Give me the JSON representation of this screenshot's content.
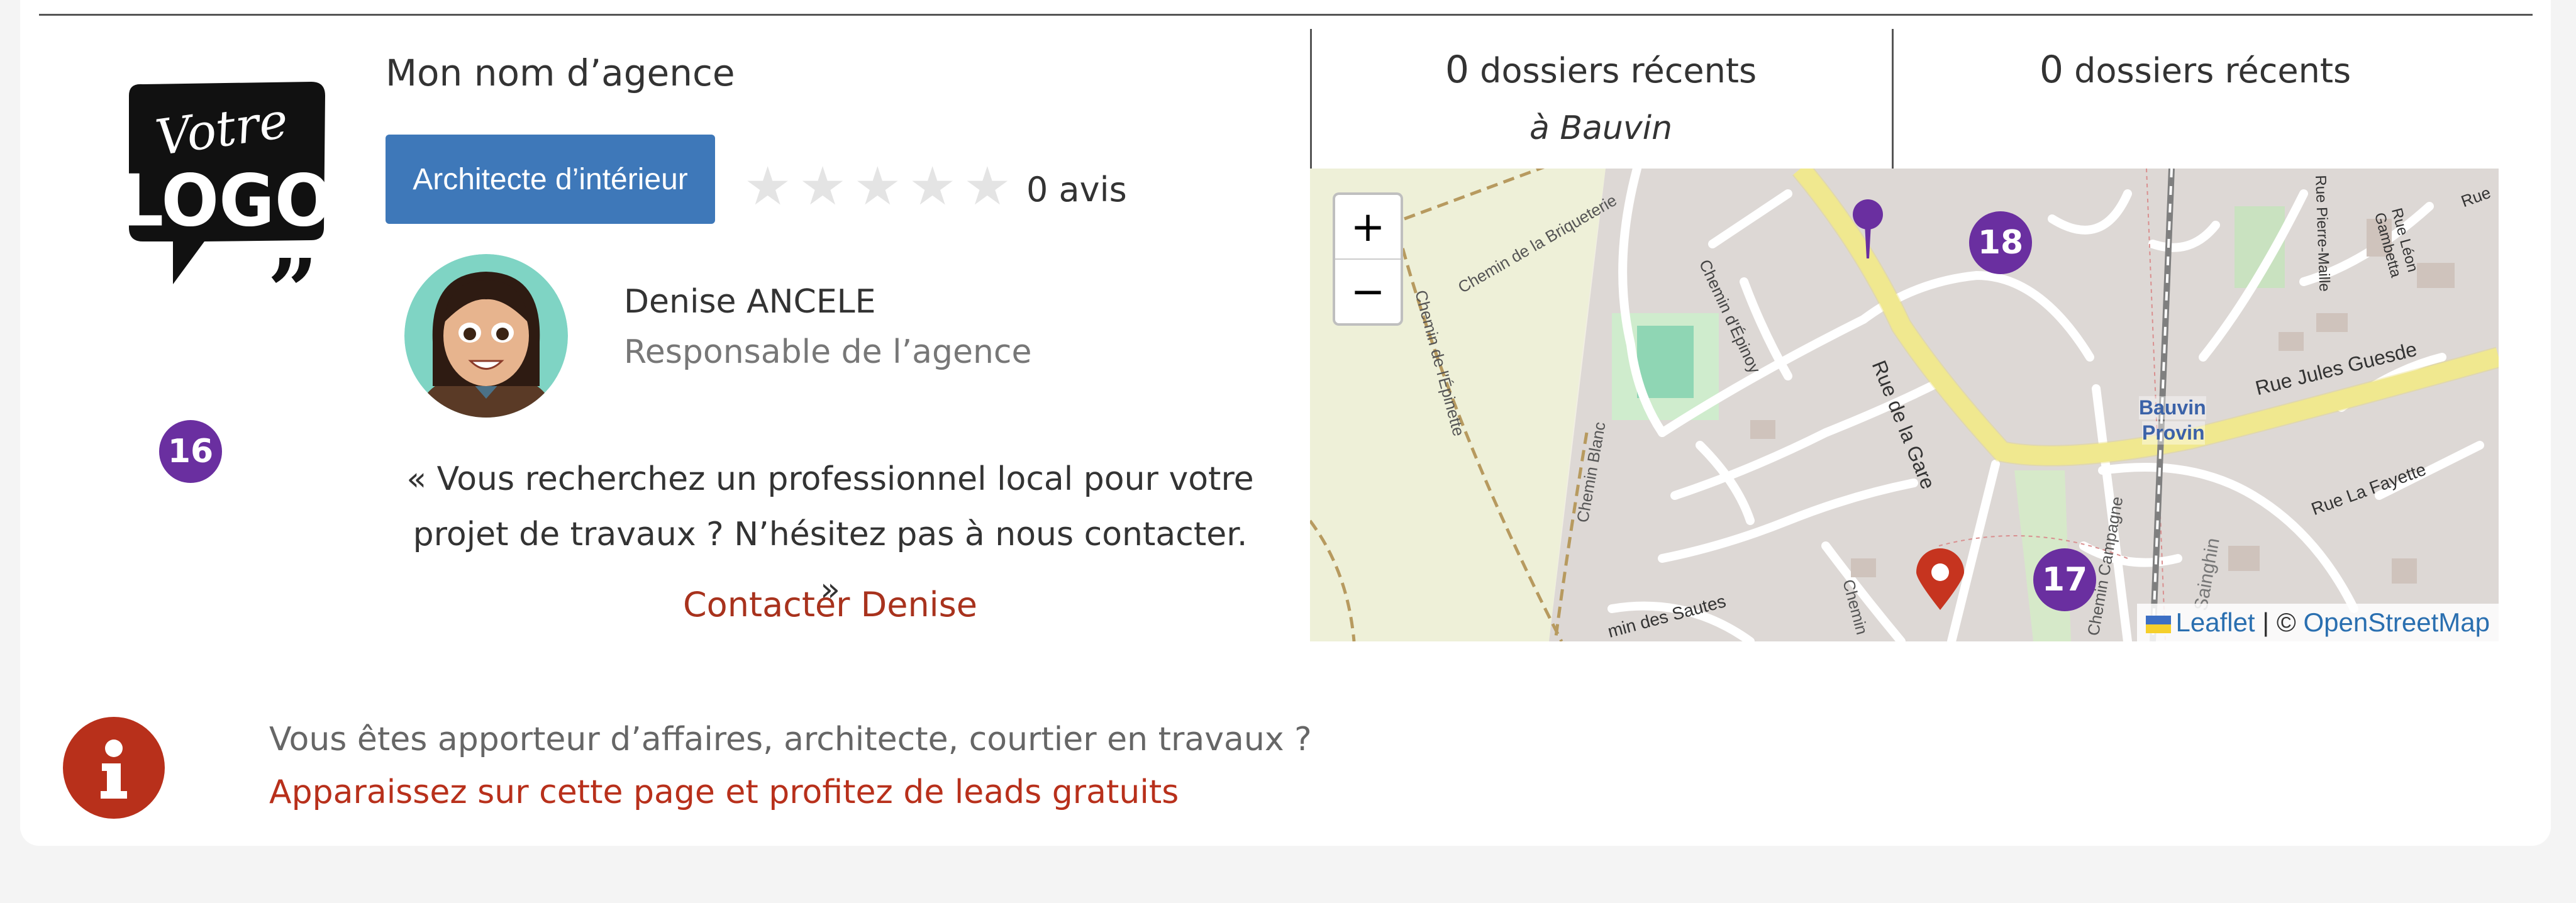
{
  "agency": {
    "name": "Mon nom d’agence",
    "logo_text_top": "Votre",
    "logo_text_bottom": "LOGO",
    "category": "Architecte d’intérieur",
    "rating_stars": 0,
    "reviews": "0 avis",
    "badge_left": "16"
  },
  "person": {
    "name": "Denise ANCELE",
    "role": "Responsable de l’agence"
  },
  "quote": "« Vous recherchez un professionnel local pour votre projet de travaux ? N’hésitez pas à nous contacter. »",
  "contact_label": "Contacter Denise",
  "stats": [
    {
      "count": "0",
      "label": "dossiers récents",
      "sub": "à Bauvin"
    },
    {
      "count": "0",
      "label": "dossiers récents",
      "sub": ""
    }
  ],
  "map": {
    "zoom_in": "+",
    "zoom_out": "−",
    "attribution_leaflet": "Leaflet",
    "attribution_sep": " | © ",
    "attribution_osm": "OpenStreetMap",
    "markers": [
      "18",
      "17"
    ],
    "street_labels": {
      "rue_de_la_gare": "Rue de la Gare",
      "rue_jules_guesde": "Rue Jules Guesde",
      "bauvin": "Bauvin",
      "provin": "Provin",
      "chemin_briqueterie": "Chemin de la Briqueterie",
      "chemin_epinette": "Chemin de l'Épinette",
      "chemin_blanc": "Chemin Blanc",
      "chemin_epinoy": "Chemin d'Épinoy",
      "rue_la_fayette": "Rue La Fayette",
      "chemin_des_sautes": "min des Sautes",
      "chemin_campagne": "Chemin Campagne",
      "sainghin": "Sainghin",
      "rue_pierre_maille": "Rue Pierre-Maille",
      "rue_leon_gambetta": "Rue Léon Gambetta",
      "rue_short": "Rue",
      "chemin_short": "Chemin"
    }
  },
  "info": {
    "line1": "Vous êtes apporteur d’affaires, architecte, courtier en travaux ?",
    "line2": "Apparaissez sur cette page et profitez de leads gratuits"
  },
  "colors": {
    "button_blue": "#3e78b9",
    "brand_red": "#b8301b",
    "badge_purple": "#6a2fa0"
  }
}
